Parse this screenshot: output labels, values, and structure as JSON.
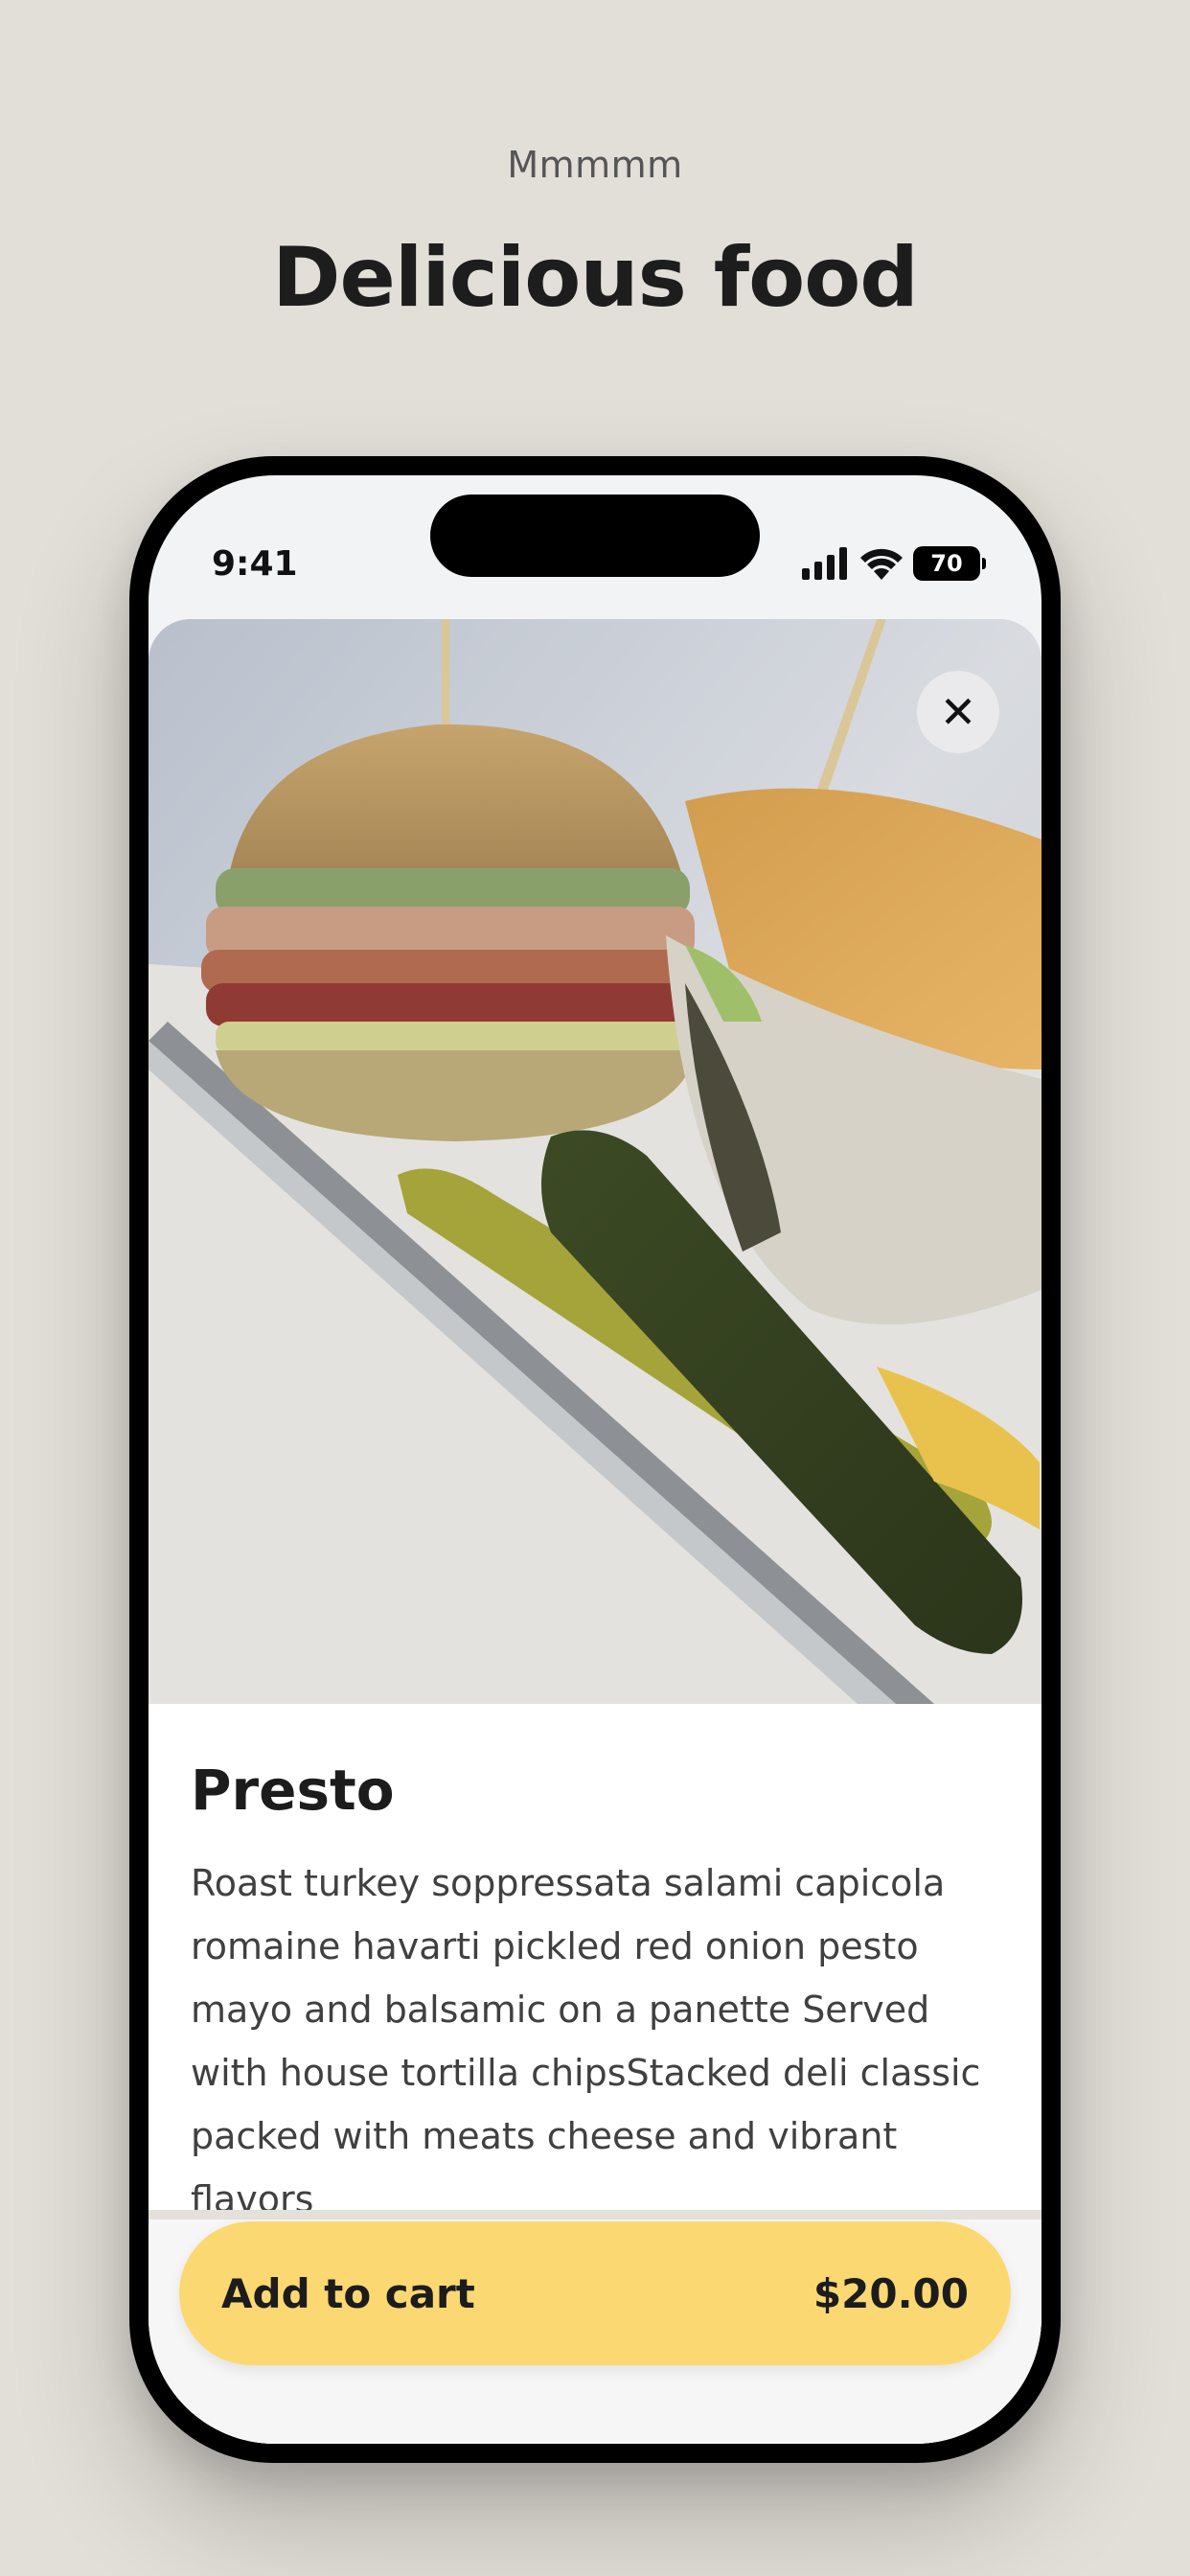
{
  "header": {
    "eyebrow": "Mmmmm",
    "title": "Delicious food"
  },
  "status_bar": {
    "time": "9:41",
    "battery": "70",
    "icons": [
      "cellular-signal-icon",
      "wifi-icon",
      "battery-icon"
    ]
  },
  "item": {
    "image_alt": "Sandwich with pickle",
    "name": "Presto",
    "description": "Roast turkey soppressata salami capicola romaine havarti pickled red onion pesto mayo and balsamic on a panette Served with house tortilla chipsStacked deli classic packed with meats cheese and vibrant flavors"
  },
  "actions": {
    "close_icon": "close-icon",
    "add_to_cart_label": "Add to cart",
    "price": "$20.00"
  },
  "colors": {
    "background": "#e2dfd8",
    "cta": "#fcd873",
    "phone_frame": "#000000"
  }
}
